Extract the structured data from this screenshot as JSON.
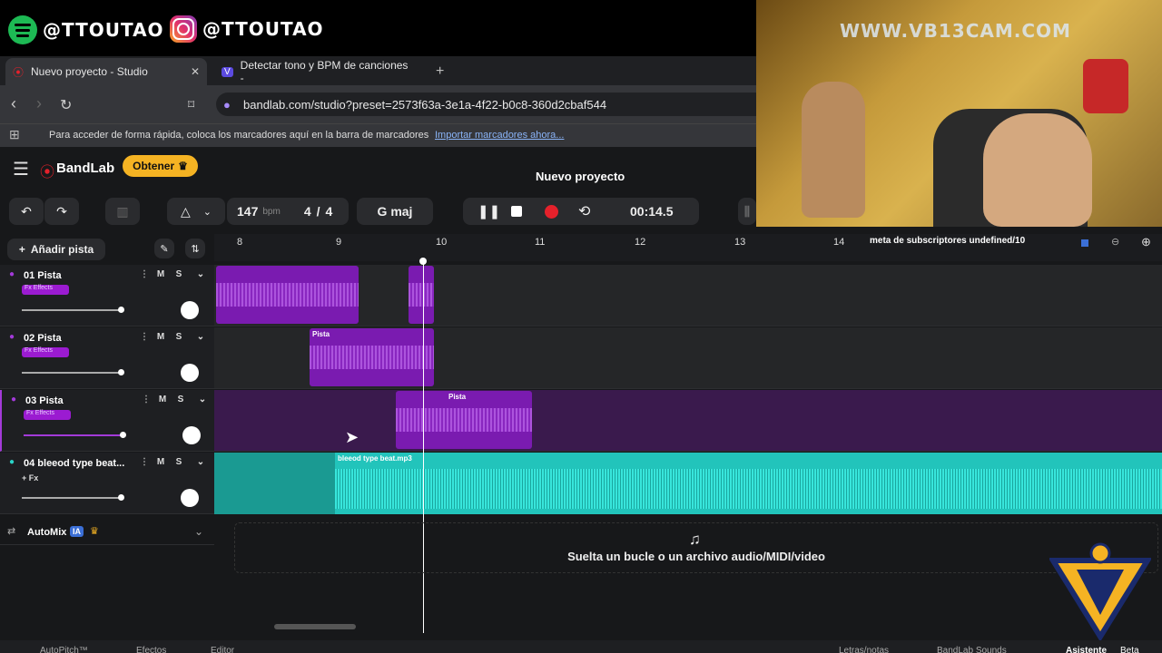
{
  "social": {
    "spotify": "@TTOUTAO",
    "instagram": "@TTOUTAO"
  },
  "browser": {
    "tabs": [
      {
        "label": "Nuevo proyecto - Studio"
      },
      {
        "label": "Detectar tono y BPM de canciones -"
      }
    ],
    "url": "bandlab.com/studio?preset=2573f63a-3e1a-4f22-b0c8-360d2cbaf544",
    "bookmarks_text": "Para acceder de forma rápida, coloca los marcadores aquí en la barra de marcadores",
    "bookmarks_link": "Importar marcadores ahora..."
  },
  "app": {
    "brand": "BandLab",
    "get_button": "Obtener",
    "project_title": "Nuevo proyecto",
    "bpm": "147",
    "bpm_unit": "bpm",
    "time_sig_num": "4",
    "time_sig_den": "4",
    "key": "G maj",
    "time": "00:14.5",
    "add_track": "Añadir pista",
    "ruler": [
      "8",
      "9",
      "10",
      "11",
      "12",
      "13",
      "14"
    ],
    "tracks": [
      {
        "name": "01 Pista",
        "fx": "Fx Effects",
        "mute": "M",
        "solo": "S"
      },
      {
        "name": "02 Pista",
        "fx": "Fx Effects",
        "mute": "M",
        "solo": "S"
      },
      {
        "name": "03 Pista",
        "fx": "Fx Effects",
        "mute": "M",
        "solo": "S"
      },
      {
        "name": "04 bleeod type beat...",
        "fx": "+ Fx",
        "mute": "M",
        "solo": "S"
      }
    ],
    "clip_labels": [
      "Pista",
      "Pista",
      "bleeod type beat.mp3"
    ],
    "automix": "AutoMix",
    "automix_badge": "IA",
    "drop_text": "Suelta un bucle o un archivo audio/MIDI/video",
    "bottom": [
      "AutoPitch™",
      "Efectos",
      "Editor",
      "Letras/notas",
      "BandLab Sounds",
      "Asistente",
      "Beta"
    ]
  },
  "overlay": {
    "watermark": "WWW.VB13CAM.COM",
    "meta": "meta de subscriptores undefined/10"
  },
  "colors": {
    "purple": "#7a1bb0",
    "cyan": "#2ad4c8",
    "accent_yellow": "#f5b323",
    "record_red": "#e5212b"
  }
}
